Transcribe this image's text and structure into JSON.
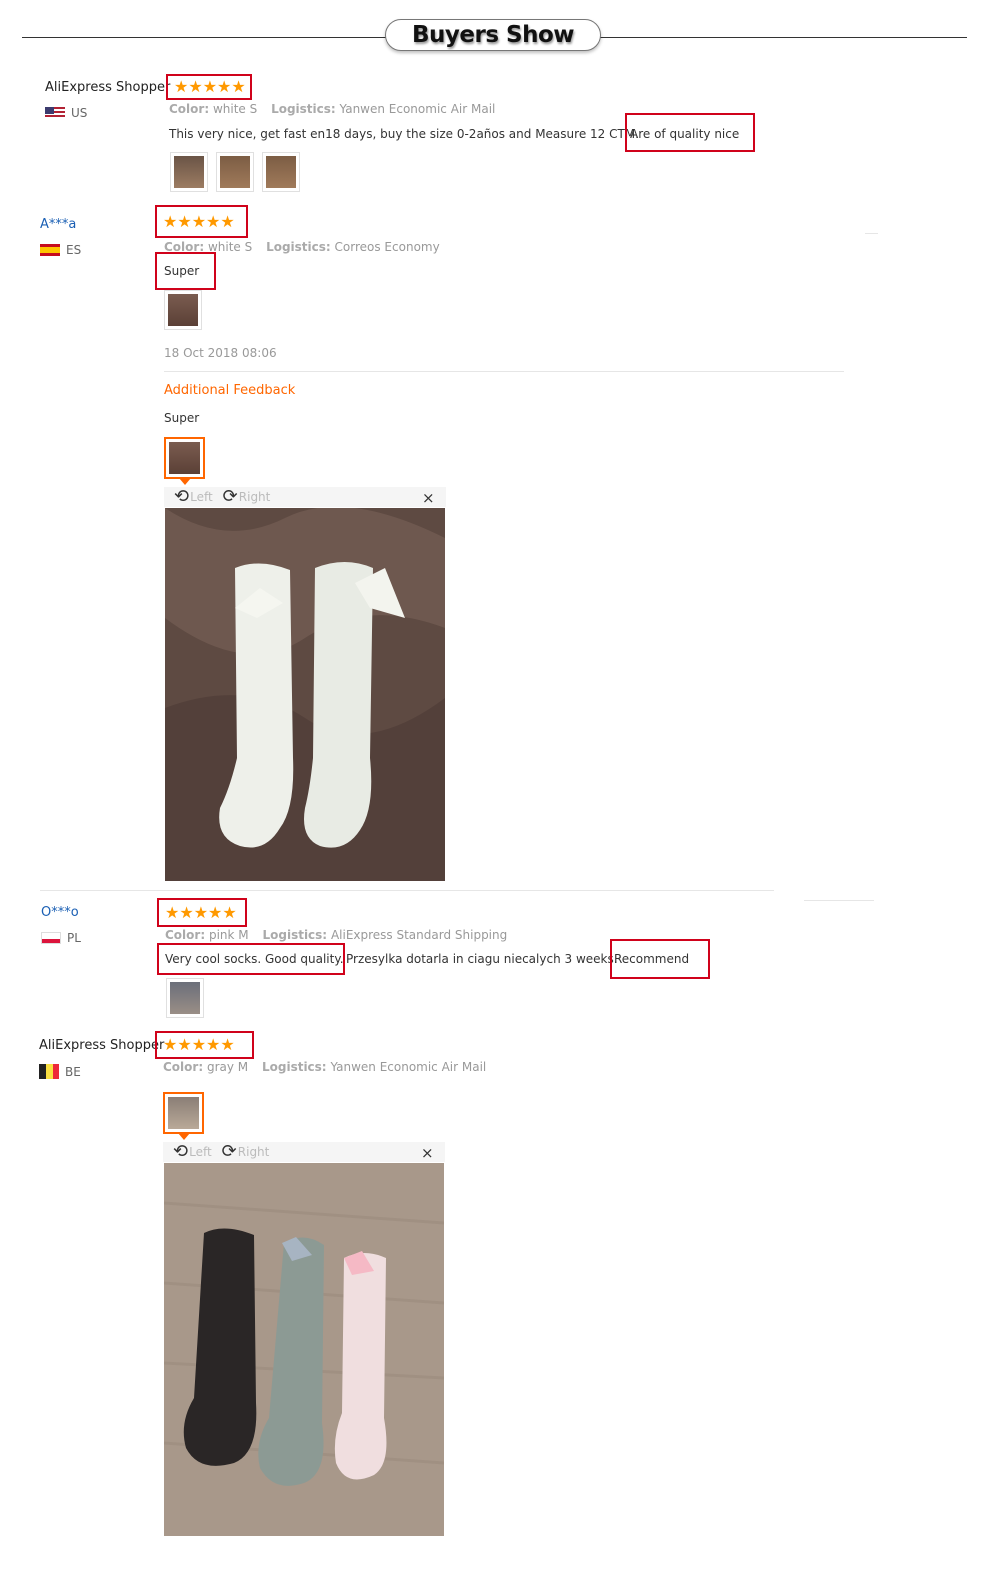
{
  "header": {
    "title": "Buyers Show"
  },
  "reviews": [
    {
      "user": "AliExpress Shopper",
      "country": "US",
      "color_label": "Color:",
      "color": "white S",
      "logistics_label": "Logistics:",
      "logistics": "Yanwen Economic Air Mail",
      "text_a": "This very nice, get fast en18 days, buy the size 0-2años and Measure 12 CTM.",
      "text_b": "Are of quality nice",
      "stars": 5
    },
    {
      "user": "A***a",
      "country": "ES",
      "color_label": "Color:",
      "color": "white S",
      "logistics_label": "Logistics:",
      "logistics": "Correos Economy",
      "text": "Super",
      "date": "18 Oct 2018 08:06",
      "additional_label": "Additional Feedback",
      "additional_text": "Super",
      "viewer": {
        "left": "Left",
        "right": "Right",
        "close": "×"
      },
      "stars": 5
    },
    {
      "user": "O***o",
      "country": "PL",
      "color_label": "Color:",
      "color": "pink M",
      "logistics_label": "Logistics:",
      "logistics": "AliExpress Standard Shipping",
      "text_a": "Very cool socks. Good quality.",
      "text_b": "Przesylka dotarla in ciagu niecalych 3 weeks.",
      "text_c": "Recommend",
      "stars": 5
    },
    {
      "user": "AliExpress Shopper",
      "country": "BE",
      "color_label": "Color:",
      "color": "gray M",
      "logistics_label": "Logistics:",
      "logistics": "Yanwen Economic Air Mail",
      "viewer": {
        "left": "Left",
        "right": "Right",
        "close": "×"
      },
      "stars": 5
    }
  ],
  "icons": {
    "star": "★",
    "rotate_left": "⟲",
    "rotate_right": "⟳"
  },
  "colors": {
    "accent": "#ff6600",
    "star": "#ff9900",
    "highlight": "#d0021b",
    "link": "#1a5fb4"
  }
}
